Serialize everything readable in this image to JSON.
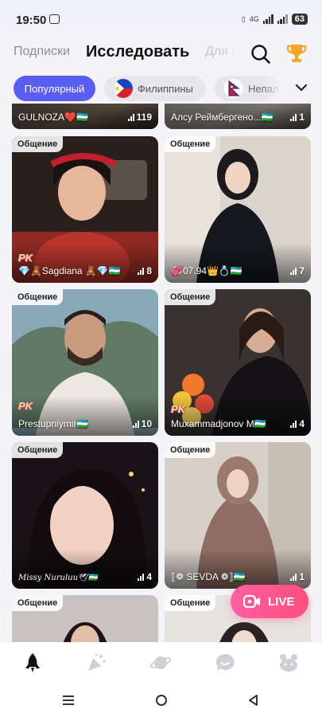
{
  "status_bar": {
    "time": "19:50",
    "network": "4G",
    "battery": "63"
  },
  "top_nav": {
    "tabs": [
      "Подписки",
      "Исследовать",
      "Для вас"
    ],
    "active_tab": "Исследовать"
  },
  "filters": {
    "chips": [
      "Популярный",
      "Филиппины",
      "Непал"
    ],
    "active_chip": "Популярный"
  },
  "feed": {
    "top_partial": [
      {
        "name": "GULNOZA❤️🇺🇿",
        "viewers": "119"
      },
      {
        "name": "Алсу Реймбергено...🇺🇿",
        "viewers": "1"
      }
    ],
    "cards": [
      {
        "badge": "Общение",
        "name": "💎🧸Sagdiana 🧸💎🇺🇿",
        "viewers": "8",
        "pk": "PK"
      },
      {
        "badge": "Общение",
        "name": "💞07.94👑💍🇺🇿",
        "viewers": "7",
        "pk": ""
      },
      {
        "badge": "Общение",
        "name": "Prestupniymir🇺🇿",
        "viewers": "10",
        "pk": "PK"
      },
      {
        "badge": "Общение",
        "name": "Muxammadjonov M🇺🇿",
        "viewers": "4",
        "pk": "PK"
      },
      {
        "badge": "Общение",
        "name": "Missy Nuruluu🕊🇺🇿",
        "viewers": "4",
        "pk": ""
      },
      {
        "badge": "Общение",
        "name": "⟦❁ SEVDA ❁⟧🇺🇿",
        "viewers": "1",
        "pk": ""
      },
      {
        "badge": "Общение",
        "name": "",
        "viewers": "",
        "pk": ""
      },
      {
        "badge": "Общение",
        "name": "",
        "viewers": "",
        "pk": ""
      }
    ]
  },
  "live_button": {
    "label": "LIVE"
  },
  "bottom_nav": {
    "icons": [
      "rocket-icon",
      "party-popper-icon",
      "planet-icon",
      "chat-bubble-icon",
      "pet-icon"
    ]
  },
  "colors": {
    "accent": "#5a5df2",
    "live": "#ff4f7c",
    "background": "#f4f4f8"
  }
}
